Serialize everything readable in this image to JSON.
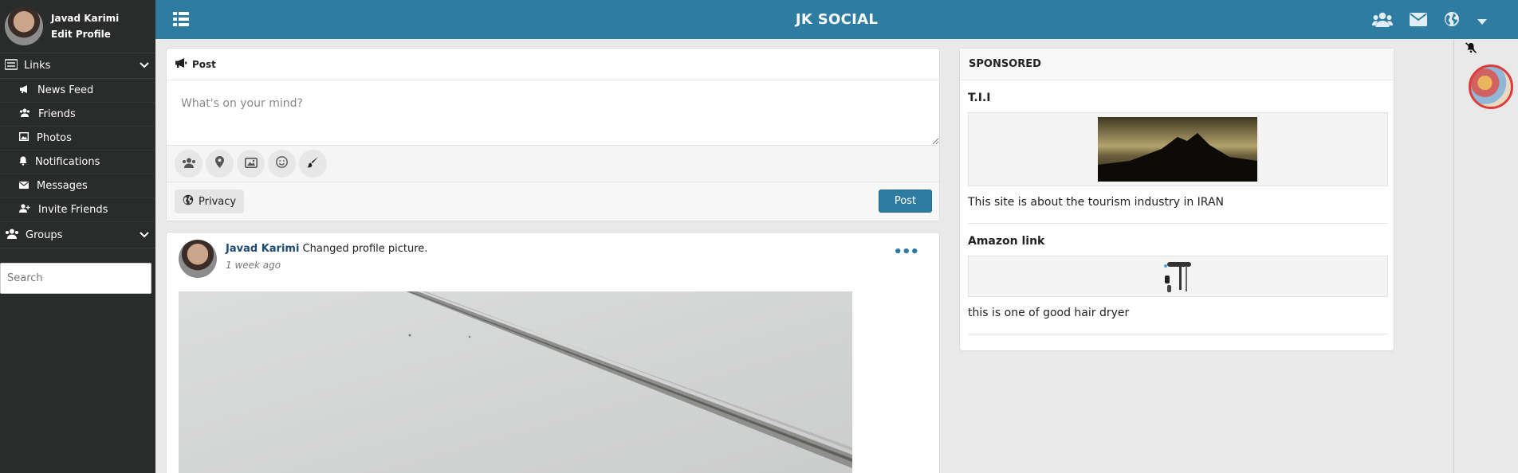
{
  "sidebar": {
    "user_name": "Javad Karimi",
    "edit_profile": "Edit Profile",
    "links_label": "Links",
    "menu": [
      {
        "label": "News Feed",
        "icon": "megaphone-icon"
      },
      {
        "label": "Friends",
        "icon": "users-icon"
      },
      {
        "label": "Photos",
        "icon": "image-icon"
      },
      {
        "label": "Notifications",
        "icon": "bell-icon"
      },
      {
        "label": "Messages",
        "icon": "envelope-icon"
      },
      {
        "label": "Invite Friends",
        "icon": "user-plus-icon"
      }
    ],
    "groups_label": "Groups",
    "search_placeholder": "Search"
  },
  "header": {
    "title": "JK SOCIAL",
    "accent": "#2f7ca3",
    "icons": [
      "grid-menu-icon",
      "users-icon",
      "envelope-icon",
      "globe-icon",
      "caret-down-icon"
    ]
  },
  "composer": {
    "title": "Post",
    "placeholder": "What's on your mind?",
    "tools": [
      "tag-friends-icon",
      "location-pin-icon",
      "photo-icon",
      "smiley-icon",
      "brush-icon"
    ],
    "privacy_label": "Privacy",
    "post_label": "Post"
  },
  "feed": {
    "posts": [
      {
        "author": "Javad Karimi",
        "action": "Changed profile picture.",
        "time": "1 week ago"
      }
    ]
  },
  "sponsored": {
    "title": "SPONSORED",
    "ads": [
      {
        "title": "T.I.I",
        "text": "This site is about the tourism industry in IRAN"
      },
      {
        "title": "Amazon link",
        "text": "this is one of good hair dryer"
      }
    ]
  }
}
